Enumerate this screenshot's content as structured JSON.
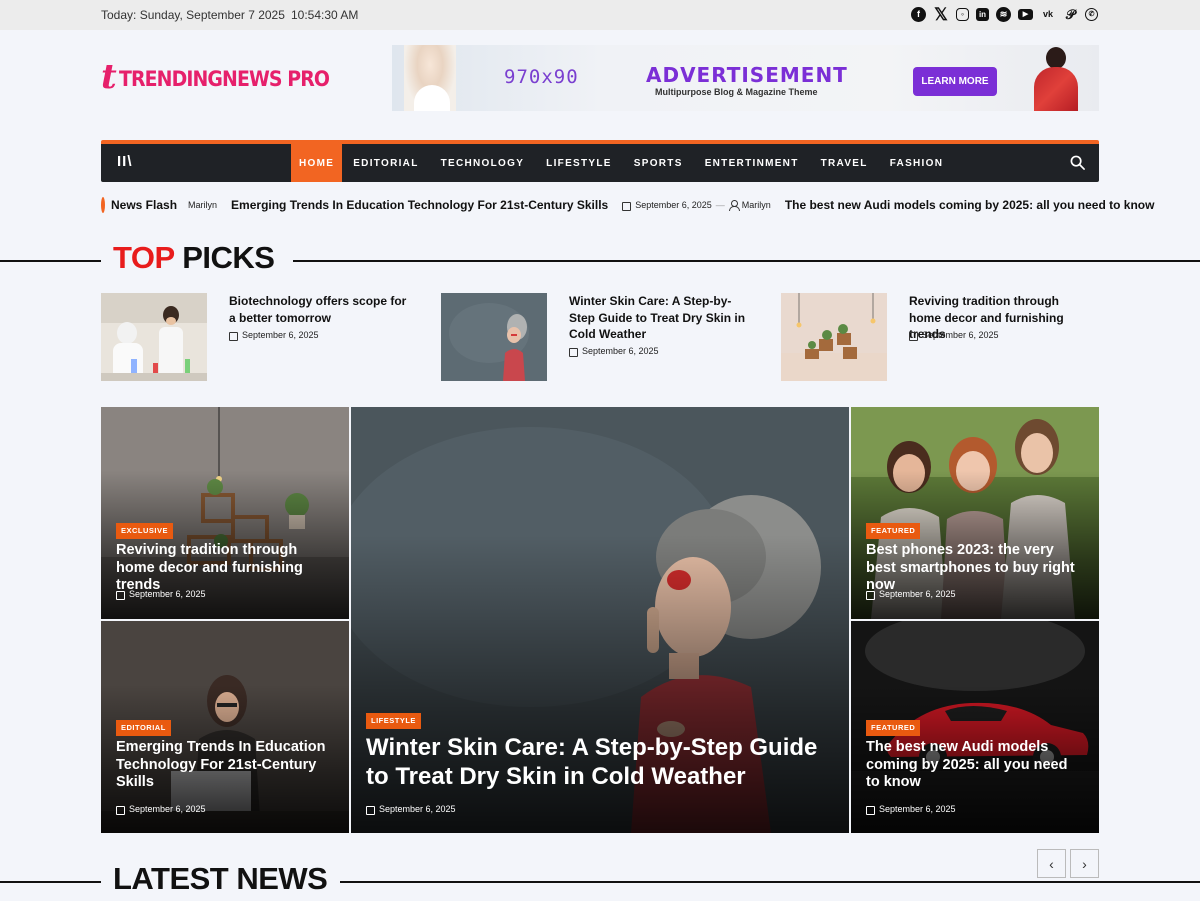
{
  "topbar": {
    "date": "Today: Sunday, September 7 2025",
    "time": "10:54:30 AM",
    "social": [
      "facebook-icon",
      "x-icon",
      "instagram-icon",
      "linkedin-icon",
      "spotify-icon",
      "youtube-icon",
      "vk-icon",
      "pinterest-icon",
      "whatsapp-icon"
    ]
  },
  "logo": {
    "mark": "t",
    "text": "TRENDINGNEWS PRO"
  },
  "ad": {
    "dimension": "970x90",
    "title": "ADVERTISEMENT",
    "subtitle": "Multipurpose Blog & Magazine Theme",
    "button": "LEARN MORE"
  },
  "nav": {
    "menu_icon": "II\\",
    "items": [
      "HOME",
      "EDITORIAL",
      "TECHNOLOGY",
      "LIFESTYLE",
      "SPORTS",
      "ENTERTINMENT",
      "TRAVEL",
      "FASHION"
    ],
    "active": "HOME"
  },
  "news_flash": {
    "label": "News Flash",
    "items": [
      {
        "author": "Marilyn",
        "headline": "Emerging Trends In Education Technology For 21st-Century Skills"
      },
      {
        "date": "September 6, 2025",
        "author": "Marilyn",
        "headline": "The best new Audi models coming by 2025: all you need to know"
      }
    ]
  },
  "top_picks": {
    "title_red": "TOP",
    "title_rest": " PICKS",
    "items": [
      {
        "title": "Biotechnology offers scope for a better tomorrow",
        "date": "September 6, 2025"
      },
      {
        "title": "Winter Skin Care: A Step-by-Step Guide to Treat Dry Skin in Cold Weather",
        "date": "September 6, 2025"
      },
      {
        "title": "Reviving tradition through home decor and furnishing trends",
        "date": "September 6, 2025"
      }
    ]
  },
  "featured": {
    "left_top": {
      "category": "EXCLUSIVE",
      "title": "Reviving tradition through home decor and furnishing trends",
      "date": "September 6, 2025"
    },
    "left_bottom": {
      "category": "EDITORIAL",
      "title": "Emerging Trends In Education Technology For 21st-Century Skills",
      "date": "September 6, 2025"
    },
    "center": {
      "category": "LIFESTYLE",
      "title": "Winter Skin Care: A Step-by-Step Guide to Treat Dry Skin in Cold Weather",
      "date": "September 6, 2025"
    },
    "right_top": {
      "category": "FEATURED",
      "title": "Best phones 2023: the very best smartphones to buy right now",
      "date": "September 6, 2025"
    },
    "right_bottom": {
      "category": "FEATURED",
      "title": "The best new Audi models coming by 2025: all you need to know",
      "date": "September 6, 2025"
    }
  },
  "latest": {
    "title": "LATEST NEWS",
    "prev": "‹",
    "next": "›"
  },
  "colors": {
    "accent": "#f26522",
    "brand": "#e6206b",
    "nav_bg": "#1f2226",
    "red_title": "#e81c1c"
  }
}
